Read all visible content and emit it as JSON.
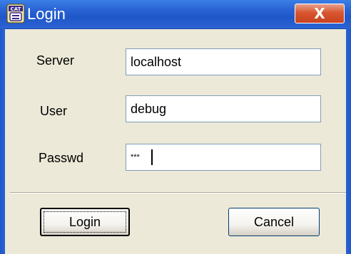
{
  "window": {
    "title": "Login",
    "app_icon": "cat-app-icon",
    "app_icon_text": "CAT",
    "close_label": "X"
  },
  "form": {
    "server": {
      "label": "Server",
      "value": "localhost"
    },
    "user": {
      "label": "User",
      "value": "debug"
    },
    "password": {
      "label": "Passwd",
      "value": "***"
    }
  },
  "buttons": {
    "login_label": "Login",
    "cancel_label": "Cancel"
  },
  "colors": {
    "titlebar": "#2a63d4",
    "close_button": "#d8562f",
    "dialog_background": "#ece9d8",
    "field_border": "#7f9db9"
  }
}
